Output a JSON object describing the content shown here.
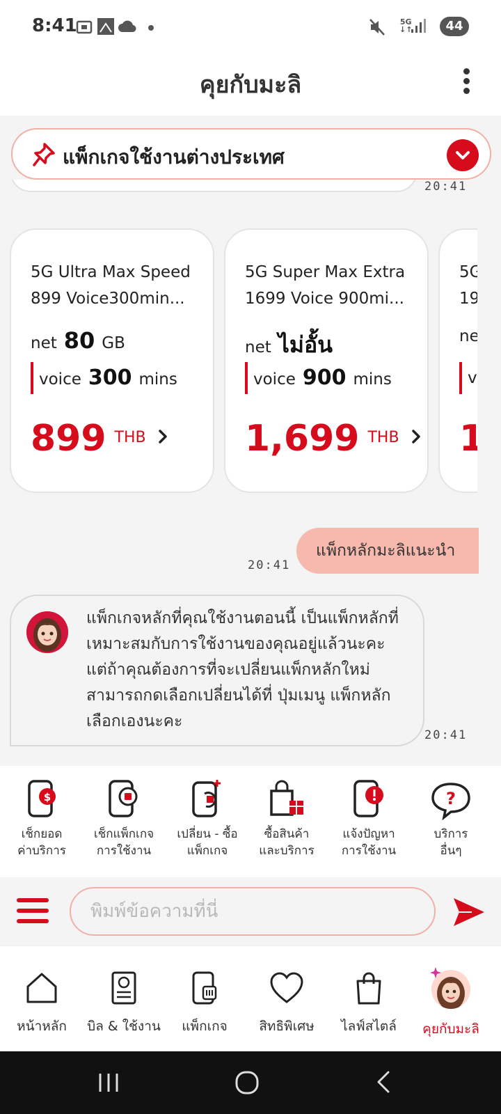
{
  "status_bar": {
    "time": "8:41",
    "network": "5G",
    "battery": "44"
  },
  "header": {
    "title": "คุยกับมะลิ"
  },
  "pinned": {
    "text": "แพ็กเกจใช้งานต่างประเทศ"
  },
  "chat": {
    "prev_timestamp": "20:41",
    "package_cards": [
      {
        "title_line1": "5G Ultra Max Speed",
        "title_line2": "899 Voice300min...",
        "net_label": "net",
        "net_value": "80",
        "net_unit": "GB",
        "voice_label": "voice",
        "voice_value": "300",
        "voice_unit": "mins",
        "price": "899",
        "currency": "THB"
      },
      {
        "title_line1": "5G Super Max Extra",
        "title_line2": "1699 Voice 900mi...",
        "net_label": "net",
        "net_value": "ไม่อั้น",
        "net_unit": "",
        "voice_label": "voice",
        "voice_value": "900",
        "voice_unit": "mins",
        "price": "1,699",
        "currency": "THB"
      },
      {
        "title_line1": "5G",
        "title_line2": "19",
        "net_label": "ne",
        "voice_label": "vo",
        "price": "1"
      }
    ],
    "user_message": "แพ็กหลักมะลิแนะนำ",
    "user_timestamp": "20:41",
    "bot_message": "แพ็กเกจหลักที่คุณใช้งานตอนนี้ เป็นแพ็กหลักที่เหมาะสมกับการใช้งานของคุณอยู่แล้วนะคะ แต่ถ้าคุณต้องการที่จะเปลี่ยนแพ็กหลักใหม่ สามารถกดเลือกเปลี่ยนได้ที่ ปุ่มเมนู แพ็กหลักเลือกเองนะคะ",
    "bot_timestamp": "20:41"
  },
  "quick_actions": [
    {
      "line1": "เช็กยอด",
      "line2": "ค่าบริการ",
      "icon": "bill-phone-icon"
    },
    {
      "line1": "เช็กแพ็กเกจ",
      "line2": "การใช้งาน",
      "icon": "package-phone-icon"
    },
    {
      "line1": "เปลี่ยน - ซื้อ",
      "line2": "แพ็กเกจ",
      "icon": "change-package-icon"
    },
    {
      "line1": "ซื้อสินค้า",
      "line2": "และบริการ",
      "icon": "shopping-gift-icon"
    },
    {
      "line1": "แจ้งปัญหา",
      "line2": "การใช้งาน",
      "icon": "report-problem-icon"
    },
    {
      "line1": "บริการ",
      "line2": "อื่นๆ",
      "icon": "help-bubble-icon"
    }
  ],
  "input": {
    "placeholder": "พิมพ์ข้อความที่นี่"
  },
  "bottom_nav": [
    {
      "label": "หน้าหลัก",
      "icon": "home-icon"
    },
    {
      "label": "บิล & ใช้งาน",
      "icon": "bill-icon"
    },
    {
      "label": "แพ็กเกจ",
      "icon": "package-icon"
    },
    {
      "label": "สิทธิพิเศษ",
      "icon": "heart-icon"
    },
    {
      "label": "ไลฟ์สไตล์",
      "icon": "shopping-bag-icon"
    },
    {
      "label": "คุยกับมะลิ",
      "icon": "mali-avatar-icon",
      "active": true
    }
  ],
  "colors": {
    "accent": "#d60c1c",
    "user_bubble": "#f7b8ad",
    "pinned_border": "#f0b0a8"
  }
}
